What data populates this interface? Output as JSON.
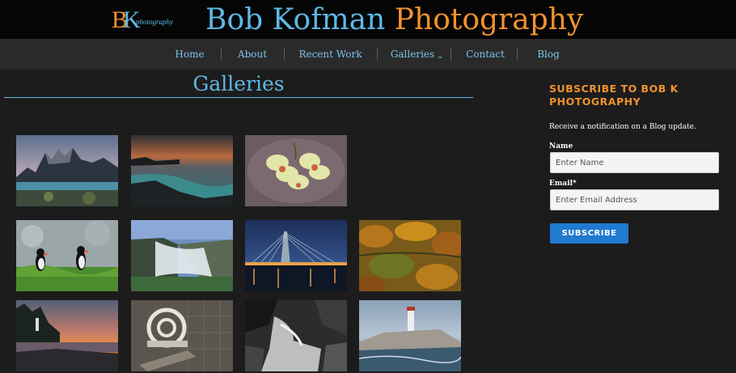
{
  "header": {
    "logo": {
      "big_letters_b": "B",
      "big_letters_k": "K",
      "sub": "photography"
    },
    "title_first": "Bob Kofman",
    "title_second": "Photography"
  },
  "nav": {
    "items": [
      {
        "label": "Home"
      },
      {
        "label": "About"
      },
      {
        "label": "Recent Work"
      },
      {
        "label": "Galleries"
      },
      {
        "label": "Contact"
      },
      {
        "label": "Blog"
      }
    ],
    "dropdown_glyph": "⌄"
  },
  "main": {
    "title": "Galleries",
    "galleries": [
      {
        "subject": "mountain peaks over lake at dusk"
      },
      {
        "subject": "rocky coastline sunset with misty waves"
      },
      {
        "subject": "yellow orchid flowers"
      },
      {
        "subject": "puffins on grassy cliff"
      },
      {
        "subject": "waterfall canyon"
      },
      {
        "subject": "illuminated bridge at night"
      },
      {
        "subject": "autumn foliage reflection"
      },
      {
        "subject": "lighthouse coast at sunset"
      },
      {
        "subject": "antique machinery wheels"
      },
      {
        "subject": "black and white cascade"
      },
      {
        "subject": "lighthouse on rocks"
      }
    ]
  },
  "sidebar": {
    "heading": "SUBSCRIBE TO BOB K PHOTOGRAPHY",
    "description": "Receive a notification on a Blog update.",
    "name_label": "Name",
    "name_placeholder": "Enter Name",
    "email_label": "Email*",
    "email_placeholder": "Enter Email Address",
    "button_label": "SUBSCRIBE"
  },
  "colors": {
    "accent_blue": "#5fb8e6",
    "accent_orange": "#f0922f",
    "button_blue": "#1f7ad0",
    "background": "#1c1c1c"
  }
}
